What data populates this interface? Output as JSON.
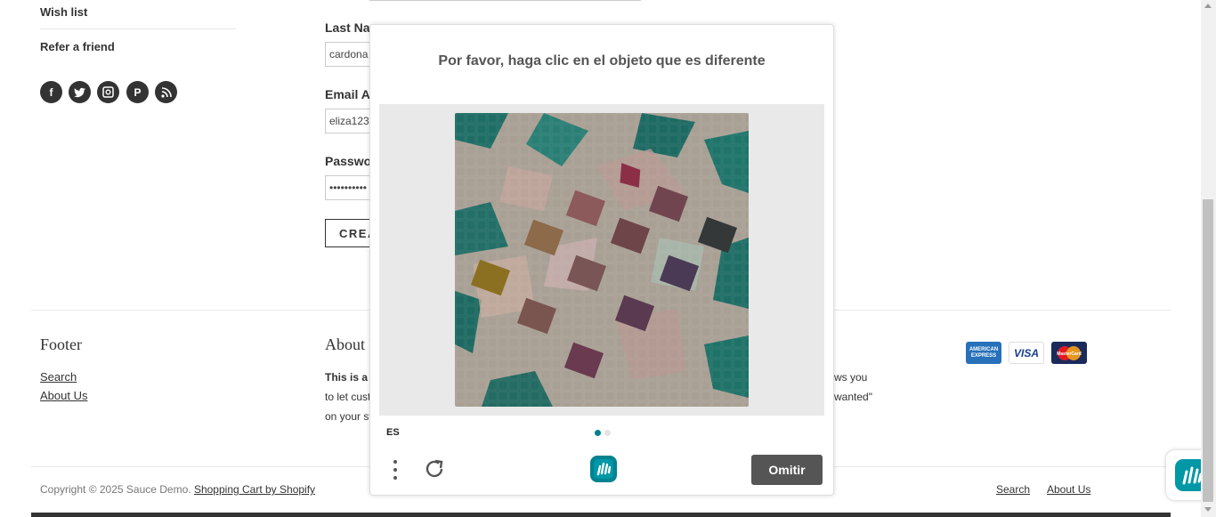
{
  "sidebar": {
    "wish_list": "Wish list",
    "refer_friend": "Refer a friend",
    "social": [
      {
        "name": "facebook-icon",
        "glyph": "f"
      },
      {
        "name": "twitter-icon",
        "glyph": "t"
      },
      {
        "name": "instagram-icon",
        "glyph": "◘"
      },
      {
        "name": "pinterest-icon",
        "glyph": "P"
      },
      {
        "name": "rss-icon",
        "glyph": "◠"
      }
    ]
  },
  "form": {
    "last_name_label": "Last Name",
    "last_name_value": "cardona",
    "email_label": "Email Address",
    "email_value": "eliza123",
    "password_label": "Password",
    "password_value": "••••••••••",
    "create_button": "CREATE"
  },
  "footer": {
    "footer_heading": "Footer",
    "links": [
      "Search",
      "About Us"
    ],
    "about_heading": "About Us",
    "about_line1_start": "This is a",
    "about_line1_end": "ws you",
    "about_line2_start": "to let cust",
    "about_line2_end": "wanted\"",
    "about_line3_start": "on your st",
    "cards": [
      "AMERICAN EXPRESS",
      "VISA",
      "MasterCard"
    ]
  },
  "captcha": {
    "title": "Por favor, haga clic en el objeto que es diferente",
    "language": "ES",
    "skip_button": "Omitir",
    "accent_color": "#00838f"
  },
  "bottom": {
    "copyright": "Copyright © 2025 Sauce Demo.",
    "shopify_link": "Shopping Cart by Shopify",
    "links": [
      "Search",
      "About Us"
    ]
  }
}
